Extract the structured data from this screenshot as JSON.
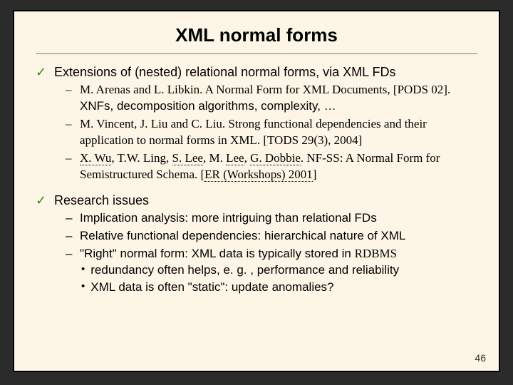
{
  "slide": {
    "title": "XML normal forms",
    "number": "46",
    "sections": [
      {
        "heading": "Extensions of (nested) relational normal forms, via XML FDs",
        "items": [
          {
            "prefix": "M. Arenas and L. Libkin. A Normal Form for XML Documents, [",
            "pods": "PODS 02",
            "middle": "]. ",
            "sans_part": "XNFs, decomposition algorithms, complexity, …"
          },
          {
            "text": "M. Vincent, J. Liu and C. Liu. Strong functional dependencies and their application to normal forms in XML. [TODS 29(3), 2004]"
          },
          {
            "a1": "X. Wu",
            "t1": ", T.W. Ling, ",
            "a2": "S. Lee",
            "t2": ", M. ",
            "a3": "Lee",
            "t3": ", ",
            "a4": "G. Dobbie",
            "t4": ". NF-SS: A Normal Form for Semistructured Schema. [",
            "a5": "ER (Workshops) 2001",
            "t5": "]"
          }
        ]
      },
      {
        "heading": "Research issues",
        "items": [
          {
            "b": "Implication analysis",
            "rest": ": more intriguing than relational FDs"
          },
          {
            "b": "Relative",
            "rest": " functional dependencies: hierarchical nature of XML"
          },
          {
            "q1": "\"",
            "b": "Right",
            "q2": "\" normal form: XML data is typically stored in ",
            "rdbms": "RDBMS",
            "bullets": [
              "redundancy often helps, e. g. , performance and reliability",
              "XML data is often \"static\": update anomalies?"
            ]
          }
        ]
      }
    ]
  }
}
